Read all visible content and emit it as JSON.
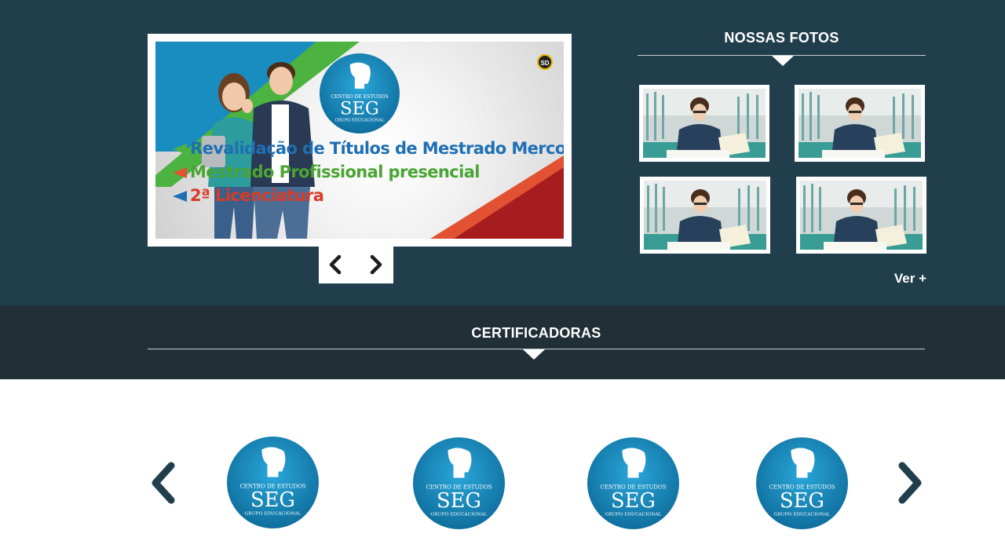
{
  "banner": {
    "logo_text_top": "CENTRO DE ESTUDOS",
    "logo_text_main": "SEG",
    "logo_text_bottom": "GRUPO EDUCACIONAL",
    "badge": "SD",
    "lines": [
      "Revalidação de Títulos de Mestrado Mercosul",
      "Mestrado Profissional presencial",
      "2ª Licenciatura"
    ]
  },
  "slider": {
    "prev_icon": "chevron-left-icon",
    "next_icon": "chevron-right-icon"
  },
  "photos": {
    "title": "NOSSAS FOTOS",
    "more_link": "Ver +",
    "items": [
      "photo-1",
      "photo-2",
      "photo-3",
      "photo-4"
    ]
  },
  "certificadoras": {
    "title": "CERTIFICADORAS",
    "logo": {
      "top": "CENTRO DE ESTUDOS",
      "main": "SEG",
      "bottom": "GRUPO EDUCACIONAL"
    },
    "prev_icon": "chevron-left-icon",
    "next_icon": "chevron-right-icon"
  },
  "colors": {
    "top_bg": "#213e4c",
    "band_bg": "#212f37",
    "logo_blue": "#1a8dc0",
    "arrow_dark": "#213e4c"
  }
}
